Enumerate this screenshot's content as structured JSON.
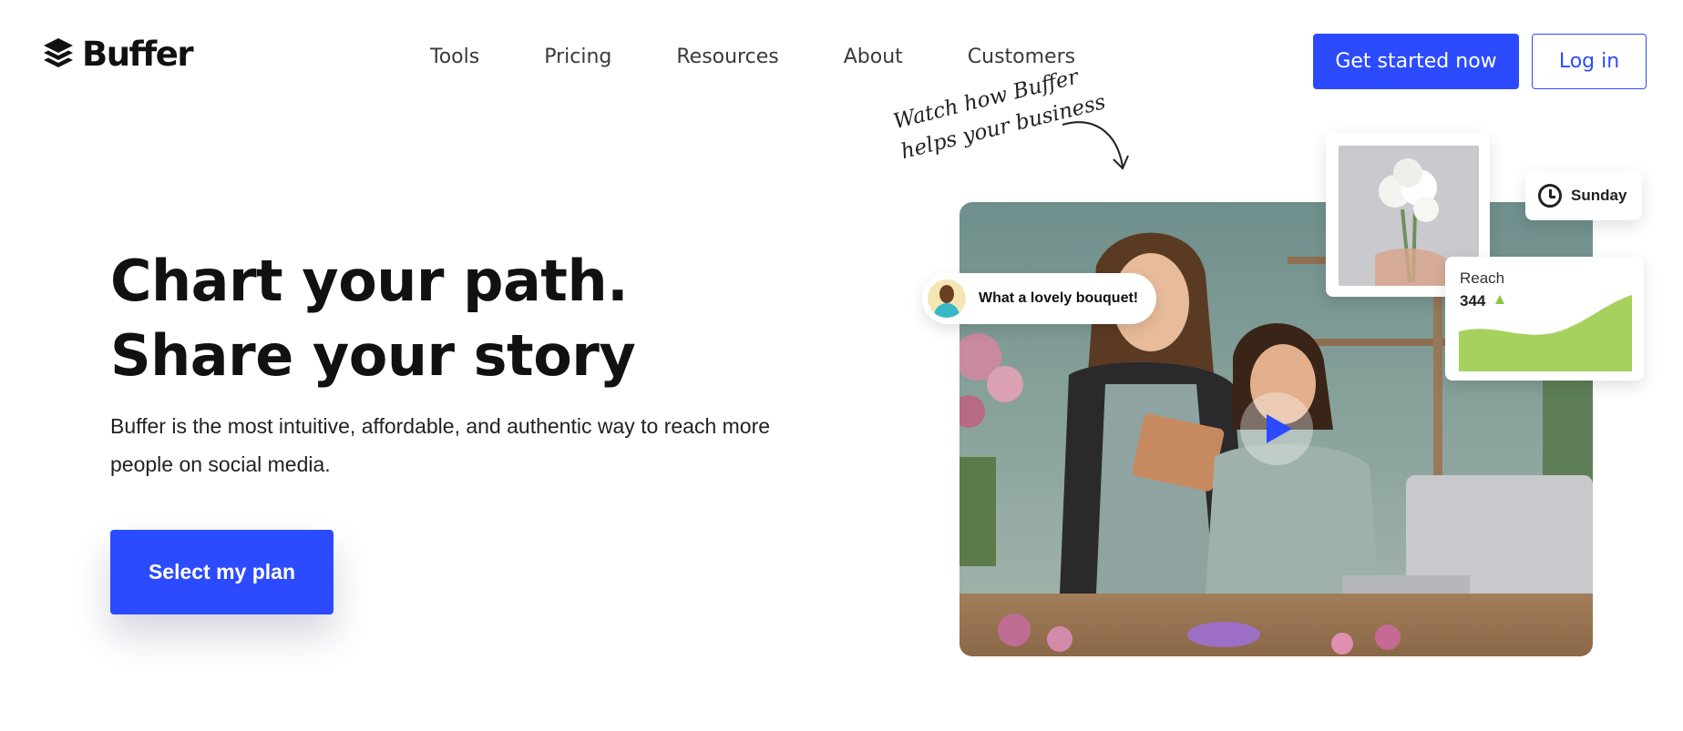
{
  "brand": {
    "name": "Buffer",
    "accent_color": "#2c4bff"
  },
  "header": {
    "nav": [
      "Tools",
      "Pricing",
      "Resources",
      "About",
      "Customers"
    ],
    "cta_label": "Get started now",
    "login_label": "Log in"
  },
  "hero": {
    "title_line1": "Chart your path.",
    "title_line2": "Share your story",
    "subtitle": "Buffer is the most intuitive, affordable, and authentic way to reach more people on social media.",
    "cta_label": "Select my plan"
  },
  "media": {
    "handwriting_line1": "Watch how Buffer",
    "handwriting_line2": "helps your business",
    "comment_text": "What a lovely bouquet!",
    "schedule_day": "Sunday",
    "reach_label": "Reach",
    "reach_value": "344",
    "reach_color": "#a6d15e"
  }
}
